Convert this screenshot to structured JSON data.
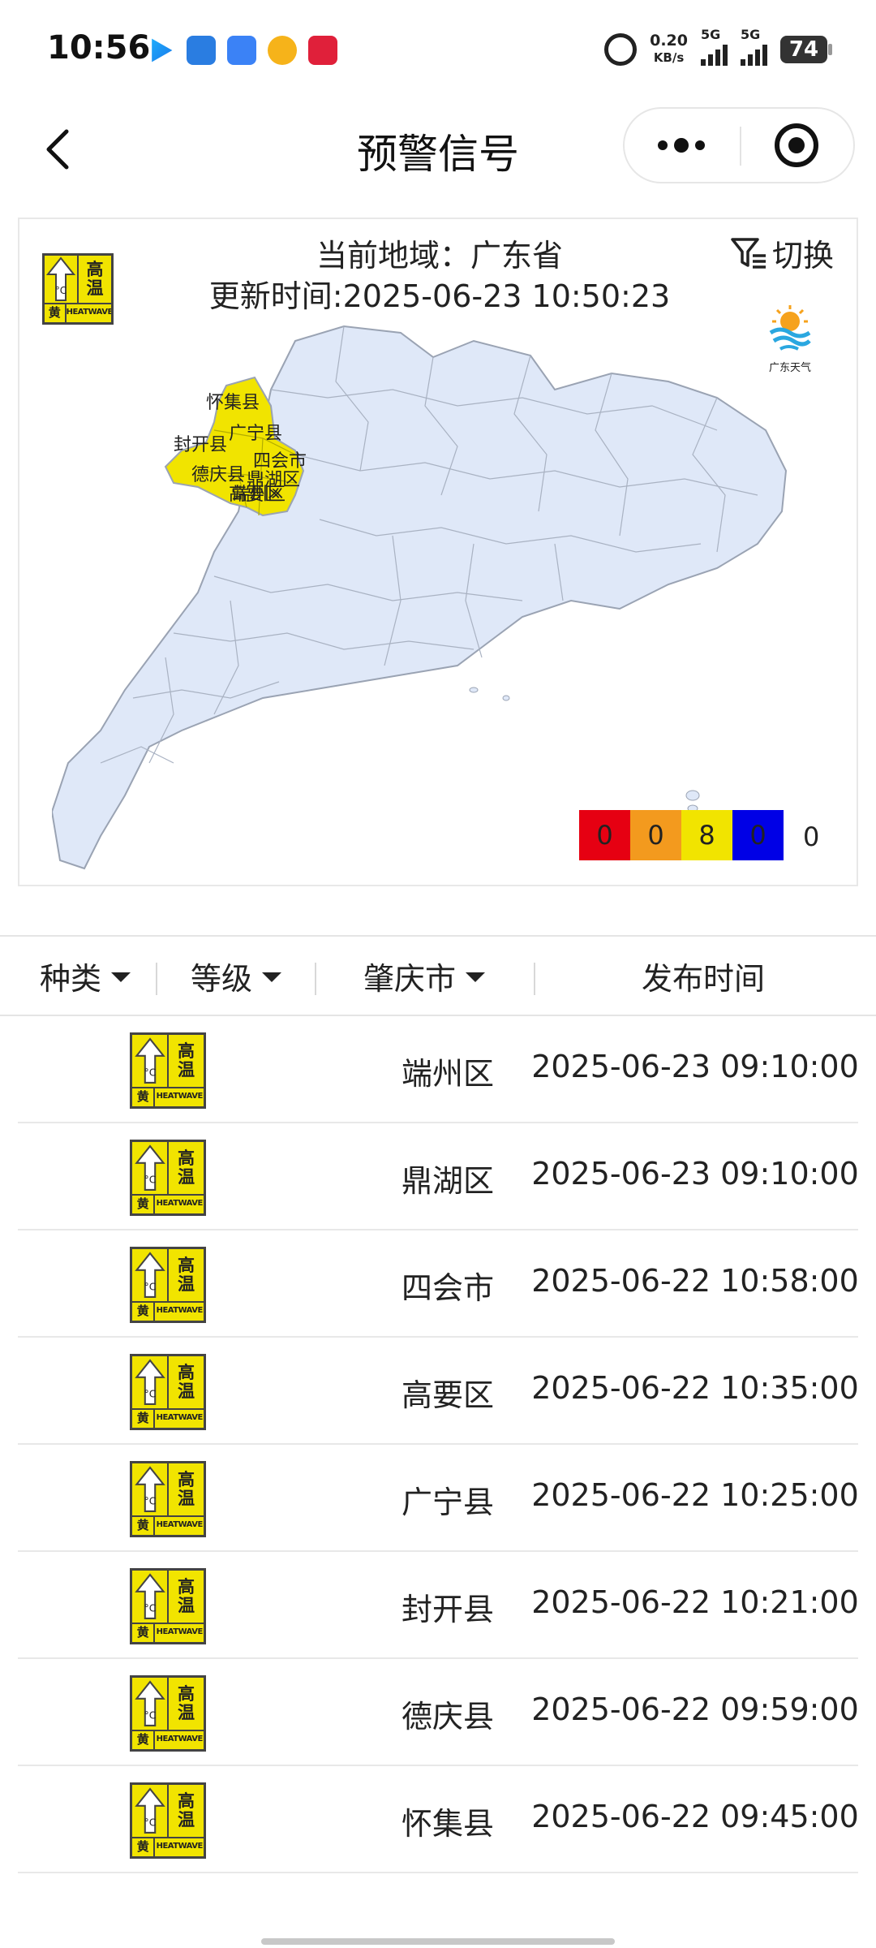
{
  "status_bar": {
    "time": "10:56",
    "net_speed_value": "0.20",
    "net_speed_unit": "KB/s",
    "sim1_label": "5G",
    "sim2_label": "5G",
    "battery": "74"
  },
  "nav": {
    "title": "预警信号",
    "back_icon": "chevron-left-icon",
    "more_icon": "more-dots-icon",
    "close_icon": "target-close-icon"
  },
  "map_panel": {
    "region_text": "当前地域：广东省",
    "update_text": "更新时间:2025-06-23 10:50:23",
    "switch_label": "切换",
    "logo_text": "广东天气",
    "map_labels": [
      "怀集县",
      "广宁县",
      "封开县",
      "四会市",
      "德庆县",
      "鼎湖区",
      "高要区",
      "端州区"
    ],
    "legend": [
      {
        "value": "0",
        "color": "#e60012"
      },
      {
        "value": "0",
        "color": "#f39a1e"
      },
      {
        "value": "8",
        "color": "#f1e400"
      },
      {
        "value": "0",
        "color": "#0000e6"
      }
    ],
    "legend_total": "0",
    "highlight_color": "#f1e400",
    "base_color": "#dfe8f8"
  },
  "badge": {
    "text_line1": "高",
    "text_line2": "温",
    "level": "黄",
    "english": "HEATWAVE",
    "color": "#f1e400"
  },
  "table": {
    "headers": {
      "type": "种类",
      "level": "等级",
      "city": "肇庆市",
      "time": "发布时间"
    },
    "rows": [
      {
        "district": "端州区",
        "time": "2025-06-23 09:10:00"
      },
      {
        "district": "鼎湖区",
        "time": "2025-06-23 09:10:00"
      },
      {
        "district": "四会市",
        "time": "2025-06-22 10:58:00"
      },
      {
        "district": "高要区",
        "time": "2025-06-22 10:35:00"
      },
      {
        "district": "广宁县",
        "time": "2025-06-22 10:25:00"
      },
      {
        "district": "封开县",
        "time": "2025-06-22 10:21:00"
      },
      {
        "district": "德庆县",
        "time": "2025-06-22 09:59:00"
      },
      {
        "district": "怀集县",
        "time": "2025-06-22 09:45:00"
      }
    ]
  }
}
